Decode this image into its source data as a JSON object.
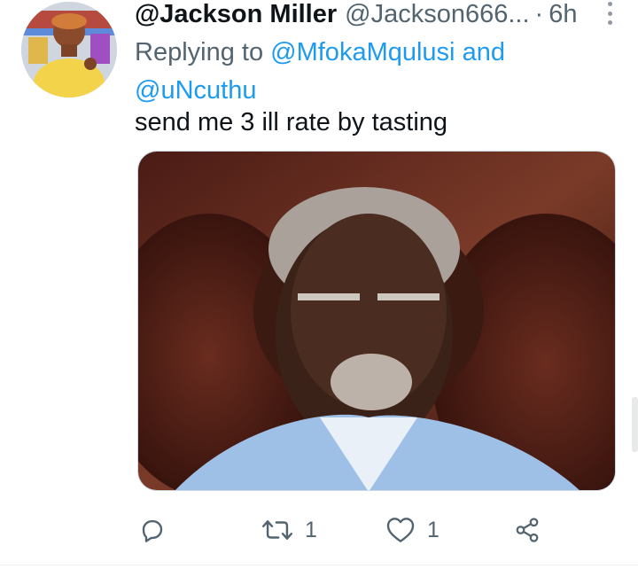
{
  "tweet": {
    "display_name": "@Jackson Miller",
    "handle": "@Jackson666...",
    "separator": "·",
    "time": "6h",
    "replying_prefix": "Replying to",
    "mention_1": "@MfokaMqulusi",
    "conjunction": "and",
    "mention_2": "@uNcuthu",
    "text": "send me 3 ill rate by tasting"
  },
  "actions": {
    "reply_icon": "reply-icon",
    "retweet_icon": "retweet-icon",
    "retweet_count": "1",
    "like_icon": "heart-icon",
    "like_count": "1",
    "share_icon": "share-icon"
  },
  "colors": {
    "text": "#0f1419",
    "secondary": "#536471",
    "link": "#1d9bf0",
    "border": "#cfd9de"
  }
}
